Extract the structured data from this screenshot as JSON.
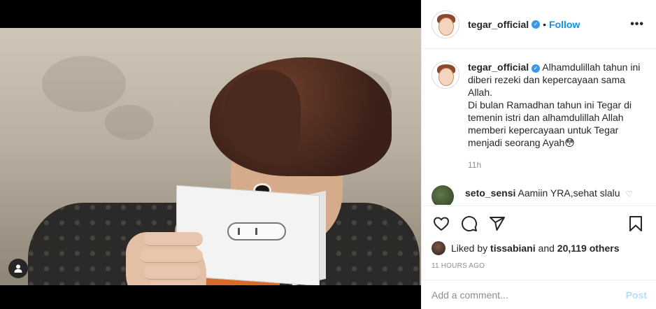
{
  "post": {
    "username": "tegar_official",
    "follow_label": "Follow",
    "more_label": "•••",
    "dot": "•"
  },
  "caption": {
    "username": "tegar_official",
    "text": "Alhamdulillah tahun ini diberi rezeki dan kepercayaan sama Allah.\nDi bulan Ramadhan tahun ini Tegar di temenin istri dan alhamdulillah Allah memberi kepercayaan untuk Tegar menjadi seorang Ayah😳",
    "time": "11h"
  },
  "comments": [
    {
      "username": "seto_sensi",
      "text": "Aamiin YRA,sehat slalu"
    }
  ],
  "likes": {
    "prefix": "Liked by",
    "user": "tissabiani",
    "middle": "and",
    "count": "20,119 others"
  },
  "timestamp": "11 HOURS AGO",
  "comment_box": {
    "placeholder": "Add a comment...",
    "post_label": "Post"
  },
  "colors": {
    "accent": "#0095f6",
    "verified": "#3897f0",
    "post_disabled": "#b2dffc"
  },
  "icons": [
    "heart-icon",
    "comment-icon",
    "share-icon",
    "bookmark-icon",
    "verified-icon",
    "more-icon",
    "user-tag-icon"
  ]
}
